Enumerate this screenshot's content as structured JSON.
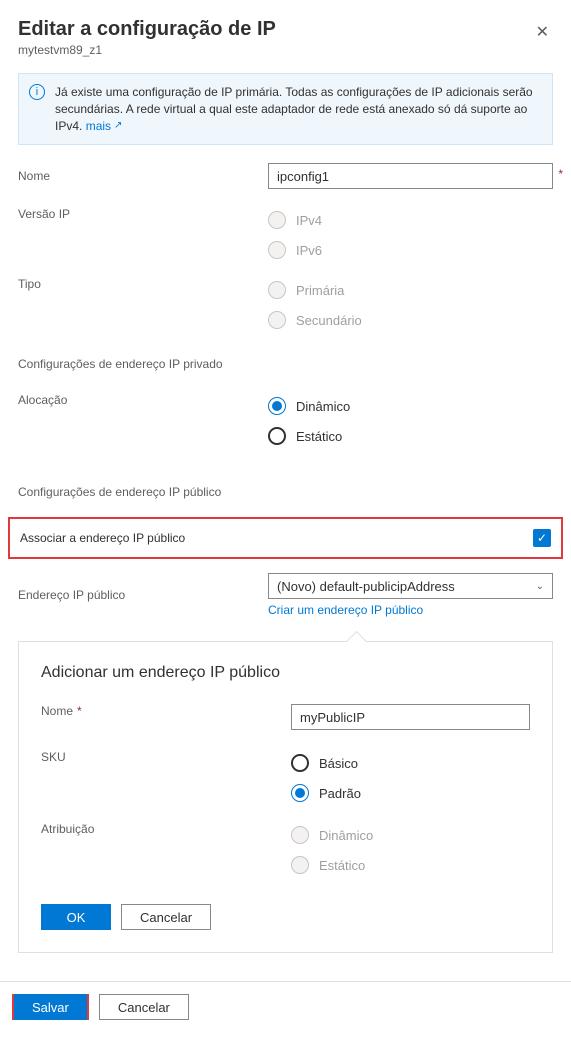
{
  "header": {
    "title": "Editar a configuração de IP",
    "subtitle": "mytestvm89_z1"
  },
  "info": {
    "text": "Já existe uma configuração de IP primária. Todas as configurações de IP adicionais serão secundárias. A rede virtual a qual este adaptador de rede está anexado só dá suporte ao IPv4.",
    "more": "mais"
  },
  "fields": {
    "name_label": "Nome",
    "name_value": "ipconfig1",
    "version_label": "Versão IP",
    "ipv4": "IPv4",
    "ipv6": "IPv6",
    "type_label": "Tipo",
    "primary": "Primária",
    "secondary": "Secundário",
    "private_section": "Configurações de endereço IP privado",
    "alloc_label": "Alocação",
    "dynamic": "Dinâmico",
    "static": "Estático",
    "public_section": "Configurações de endereço IP público",
    "associate_label": "Associar a endereço IP público",
    "public_addr_label": "Endereço IP público",
    "public_addr_value": "(Novo) default-publicipAddress",
    "create_public_link": "Criar um endereço IP público"
  },
  "callout": {
    "title": "Adicionar um endereço IP público",
    "name_label": "Nome",
    "name_value": "myPublicIP",
    "sku_label": "SKU",
    "sku_basic": "Básico",
    "sku_standard": "Padrão",
    "assign_label": "Atribuição",
    "assign_dynamic": "Dinâmico",
    "assign_static": "Estático",
    "ok": "OK",
    "cancel": "Cancelar"
  },
  "footer": {
    "save": "Salvar",
    "cancel": "Cancelar"
  }
}
